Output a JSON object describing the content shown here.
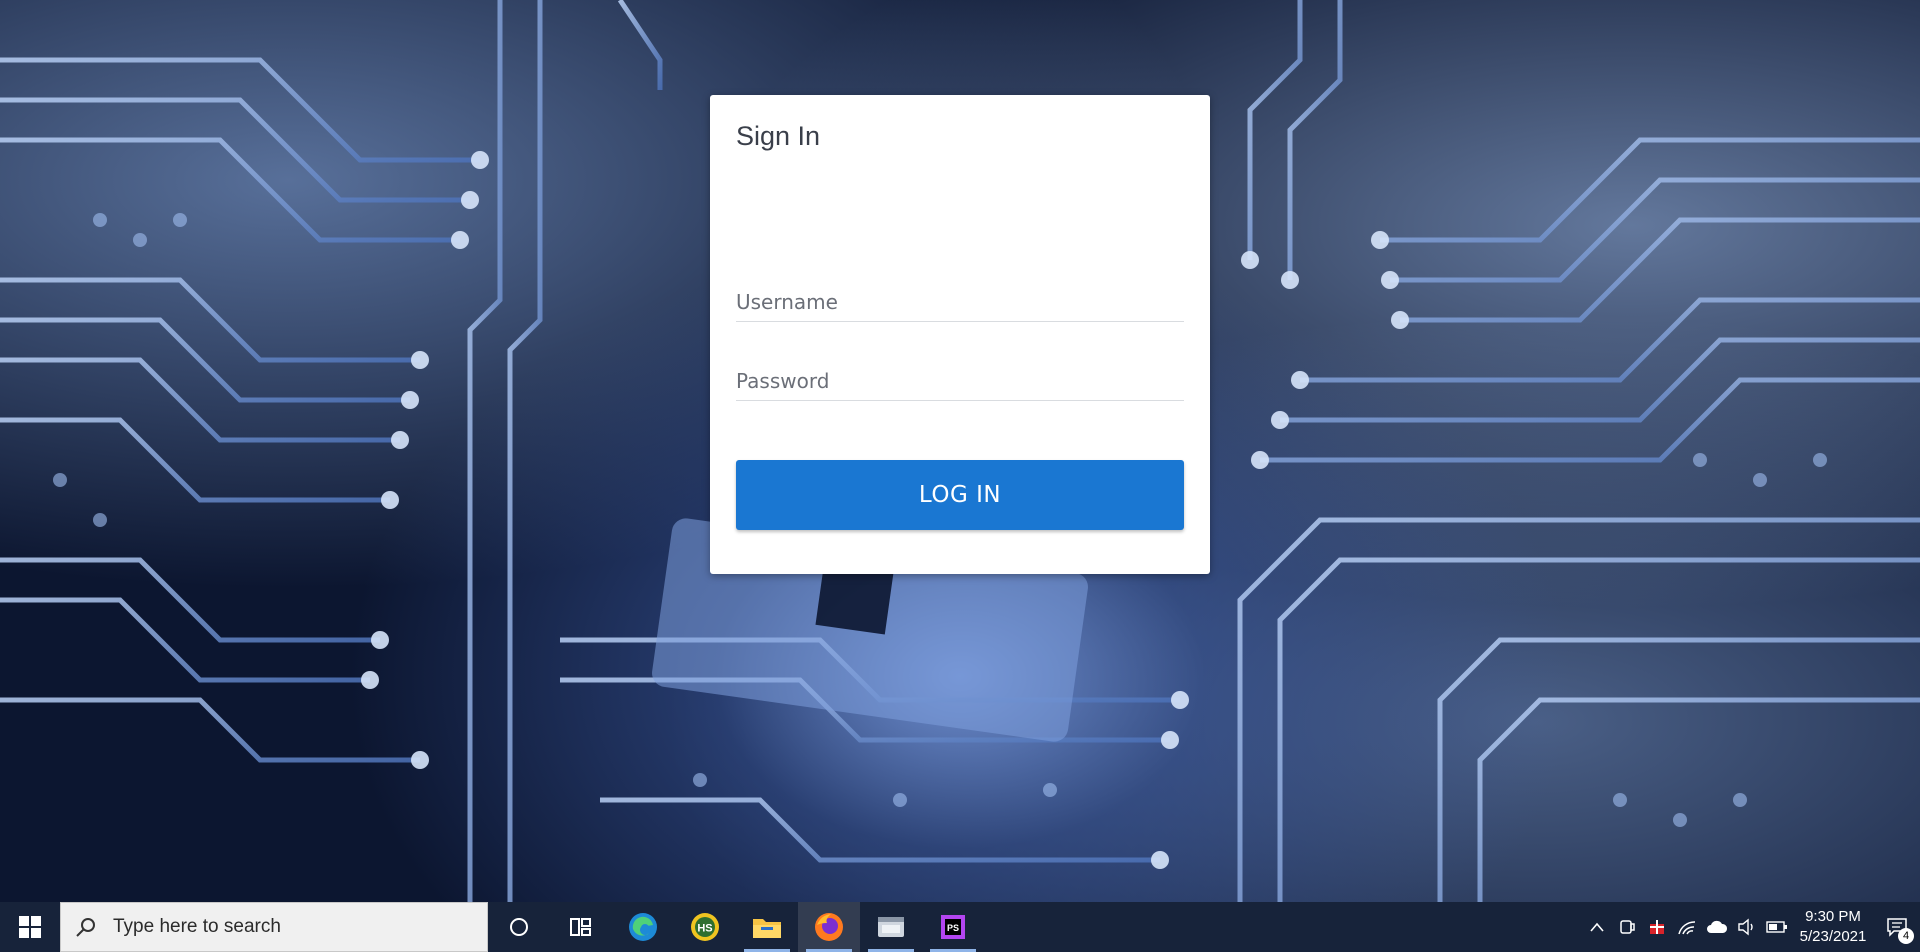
{
  "login": {
    "title": "Sign In",
    "username_placeholder": "Username",
    "password_placeholder": "Password",
    "login_label": "LOG IN"
  },
  "colors": {
    "primary": "#1a77d2",
    "taskbar": "#17233a"
  },
  "taskbar": {
    "search_placeholder": "Type here to search",
    "apps": [
      {
        "name": "cortana-icon"
      },
      {
        "name": "task-view-icon"
      },
      {
        "name": "edge-icon"
      },
      {
        "name": "hs-app-icon",
        "label": "HS"
      },
      {
        "name": "file-explorer-icon"
      },
      {
        "name": "firefox-icon"
      },
      {
        "name": "window-app-icon"
      },
      {
        "name": "phpstorm-icon",
        "label": "PS"
      }
    ],
    "time": "9:30 PM",
    "date": "5/23/2021",
    "notification_count": "4"
  }
}
